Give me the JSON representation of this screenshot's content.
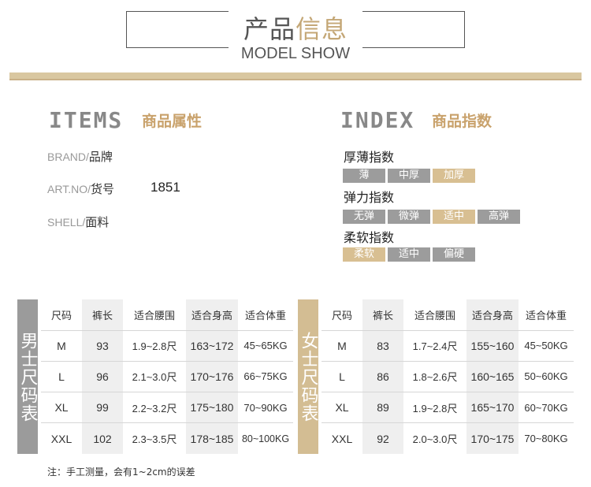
{
  "header": {
    "title_part1": "产品",
    "title_part2": "信息",
    "subtitle": "MODEL SHOW"
  },
  "items": {
    "title_en": "ITEMS",
    "title_cn": "商品属性",
    "properties": [
      {
        "en": "BRAND/",
        "cn": "品牌",
        "value": ""
      },
      {
        "en": "ART.NO/",
        "cn": "货号",
        "value": "1851"
      },
      {
        "en": "SHELL/",
        "cn": "面料",
        "value": ""
      }
    ]
  },
  "index": {
    "title_en": "INDEX",
    "title_cn": "商品指数",
    "groups": [
      {
        "label": "厚薄指数",
        "options": [
          {
            "text": "薄",
            "selected": false
          },
          {
            "text": "中厚",
            "selected": false
          },
          {
            "text": "加厚",
            "selected": true
          }
        ]
      },
      {
        "label": "弹力指数",
        "options": [
          {
            "text": "无弹",
            "selected": false
          },
          {
            "text": "微弹",
            "selected": false
          },
          {
            "text": "适中",
            "selected": true
          },
          {
            "text": "高弹",
            "selected": false
          }
        ]
      },
      {
        "label": "柔软指数",
        "options": [
          {
            "text": "柔软",
            "selected": true
          },
          {
            "text": "适中",
            "selected": false
          },
          {
            "text": "偏硬",
            "selected": false
          }
        ]
      }
    ]
  },
  "men_table": {
    "label": "男士尺码表",
    "headers": [
      "尺码",
      "裤长",
      "适合腰围",
      "适合身高",
      "适合体重"
    ],
    "rows": [
      [
        "M",
        "93",
        "1.9~2.8尺",
        "163~172",
        "45~65KG"
      ],
      [
        "L",
        "96",
        "2.1~3.0尺",
        "170~176",
        "66~75KG"
      ],
      [
        "XL",
        "99",
        "2.2~3.2尺",
        "175~180",
        "70~90KG"
      ],
      [
        "XXL",
        "102",
        "2.3~3.5尺",
        "178~185",
        "80~100KG"
      ]
    ]
  },
  "women_table": {
    "label": "女士尺码表",
    "headers": [
      "尺码",
      "裤长",
      "适合腰围",
      "适合身高",
      "适合体重"
    ],
    "rows": [
      [
        "M",
        "83",
        "1.7~2.4尺",
        "155~160",
        "45~50KG"
      ],
      [
        "L",
        "86",
        "1.8~2.6尺",
        "160~165",
        "50~60KG"
      ],
      [
        "XL",
        "89",
        "1.9~2.8尺",
        "165~170",
        "60~70KG"
      ],
      [
        "XXL",
        "92",
        "2.0~3.0尺",
        "170~175",
        "70~80KG"
      ]
    ]
  },
  "note": "注：手工测量，会有1~2cm的误差",
  "colors": {
    "gold": "#c9a26c",
    "gold_chip": "#d8bf92",
    "grey_chip": "#9c9c9c",
    "men_side": "#9b9b9b",
    "women_side": "#d3bd93"
  }
}
